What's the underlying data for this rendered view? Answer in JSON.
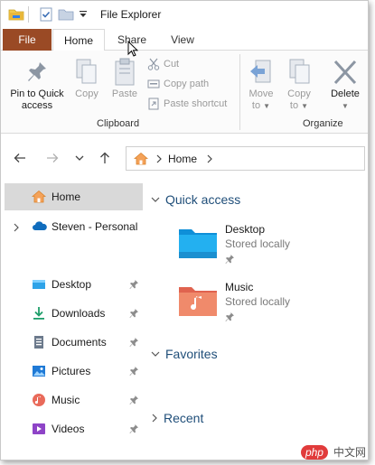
{
  "window": {
    "title": "File Explorer"
  },
  "colors": {
    "file_tab": "#9a4a25",
    "accent_text": "#1f4e79",
    "selected_bg": "#d9d9d9"
  },
  "tabs": [
    {
      "label": "File",
      "icon": null
    },
    {
      "label": "Home",
      "active": true
    },
    {
      "label": "Share"
    },
    {
      "label": "View"
    }
  ],
  "ribbon": {
    "clipboard": {
      "pin": {
        "line1": "Pin to Quick",
        "line2": "access"
      },
      "copy": "Copy",
      "paste": "Paste",
      "cut": "Cut",
      "copy_path": "Copy path",
      "paste_shortcut": "Paste shortcut",
      "group_label": "Clipboard"
    },
    "organize": {
      "move_to": {
        "line1": "Move",
        "line2": "to"
      },
      "copy_to": {
        "line1": "Copy",
        "line2": "to"
      },
      "delete": "Delete",
      "group_label": "Organize"
    }
  },
  "address": {
    "crumb": "Home",
    "home_icon": "home-icon"
  },
  "nav_pane": {
    "items": [
      {
        "label": "Home",
        "icon": "home-icon",
        "selected": true
      },
      {
        "label": "Steven - Personal",
        "icon": "onedrive-icon",
        "expandable": true
      },
      {
        "label": "Desktop",
        "icon": "desktop-folder-icon",
        "pinned": true
      },
      {
        "label": "Downloads",
        "icon": "downloads-icon",
        "pinned": true
      },
      {
        "label": "Documents",
        "icon": "documents-icon",
        "pinned": true
      },
      {
        "label": "Pictures",
        "icon": "pictures-icon",
        "pinned": true
      },
      {
        "label": "Music",
        "icon": "music-icon",
        "pinned": true
      },
      {
        "label": "Videos",
        "icon": "videos-icon",
        "pinned": true
      }
    ]
  },
  "content": {
    "sections": {
      "quick_access": "Quick access",
      "favorites": "Favorites",
      "recent": "Recent"
    },
    "quick_access_items": [
      {
        "name": "Desktop",
        "status": "Stored locally",
        "icon": "desktop-folder-icon"
      },
      {
        "name": "Music",
        "status": "Stored locally",
        "icon": "music-folder-icon"
      }
    ]
  },
  "watermark": {
    "badge": "php",
    "text": "中文网"
  }
}
